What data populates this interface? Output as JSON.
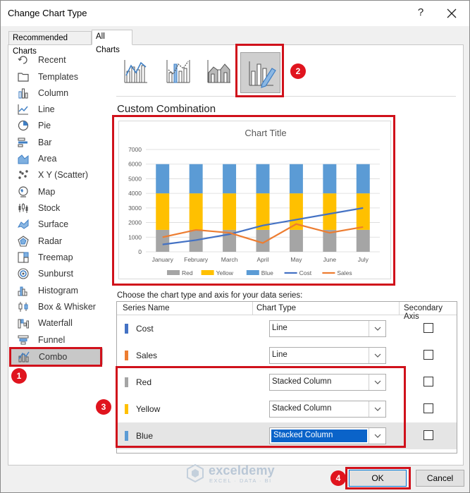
{
  "window": {
    "title": "Change Chart Type",
    "help": "?"
  },
  "tabs": [
    {
      "label": "Recommended Charts"
    },
    {
      "label": "All Charts"
    }
  ],
  "sidebar": {
    "items": [
      {
        "label": "Recent"
      },
      {
        "label": "Templates"
      },
      {
        "label": "Column"
      },
      {
        "label": "Line"
      },
      {
        "label": "Pie"
      },
      {
        "label": "Bar"
      },
      {
        "label": "Area"
      },
      {
        "label": "X Y (Scatter)"
      },
      {
        "label": "Map"
      },
      {
        "label": "Stock"
      },
      {
        "label": "Surface"
      },
      {
        "label": "Radar"
      },
      {
        "label": "Treemap"
      },
      {
        "label": "Sunburst"
      },
      {
        "label": "Histogram"
      },
      {
        "label": "Box & Whisker"
      },
      {
        "label": "Waterfall"
      },
      {
        "label": "Funnel"
      },
      {
        "label": "Combo"
      }
    ],
    "selected": "Combo"
  },
  "section_title": "Custom Combination",
  "chart_data": {
    "type": "bar",
    "title": "Chart Title",
    "categories": [
      "January",
      "February",
      "March",
      "April",
      "May",
      "June",
      "July"
    ],
    "ylim": [
      0,
      7000
    ],
    "yticks": [
      0,
      1000,
      2000,
      3000,
      4000,
      5000,
      6000,
      7000
    ],
    "series": [
      {
        "name": "Red",
        "kind": "stacked-column",
        "color": "#a5a5a5",
        "values": [
          1500,
          1500,
          1500,
          1500,
          1500,
          1500,
          1500
        ]
      },
      {
        "name": "Yellow",
        "kind": "stacked-column",
        "color": "#ffc000",
        "values": [
          2500,
          2500,
          2500,
          2500,
          2500,
          2500,
          2500
        ]
      },
      {
        "name": "Blue",
        "kind": "stacked-column",
        "color": "#5b9bd5",
        "values": [
          2000,
          2000,
          2000,
          2000,
          2000,
          2000,
          2000
        ]
      },
      {
        "name": "Cost",
        "kind": "line",
        "color": "#4472c4",
        "values": [
          500,
          800,
          1200,
          1800,
          2200,
          2600,
          3000
        ]
      },
      {
        "name": "Sales",
        "kind": "line",
        "color": "#ed7d31",
        "values": [
          1000,
          1500,
          1300,
          600,
          1900,
          1300,
          1700
        ]
      }
    ],
    "legend": "bottom",
    "grid": true
  },
  "series_table": {
    "instruction": "Choose the chart type and axis for your data series:",
    "headers": {
      "name": "Series Name",
      "type": "Chart Type",
      "axis": "Secondary Axis"
    },
    "rows": [
      {
        "name": "Cost",
        "color": "#4472c4",
        "type": "Line"
      },
      {
        "name": "Sales",
        "color": "#ed7d31",
        "type": "Line"
      },
      {
        "name": "Red",
        "color": "#a5a5a5",
        "type": "Stacked Column"
      },
      {
        "name": "Yellow",
        "color": "#ffc000",
        "type": "Stacked Column"
      },
      {
        "name": "Blue",
        "color": "#5b9bd5",
        "type": "Stacked Column"
      }
    ]
  },
  "buttons": {
    "ok": "OK",
    "cancel": "Cancel"
  },
  "badges": [
    "1",
    "2",
    "3",
    "4"
  ],
  "watermark": {
    "name": "exceldemy",
    "tagline": "EXCEL · DATA · BI"
  }
}
